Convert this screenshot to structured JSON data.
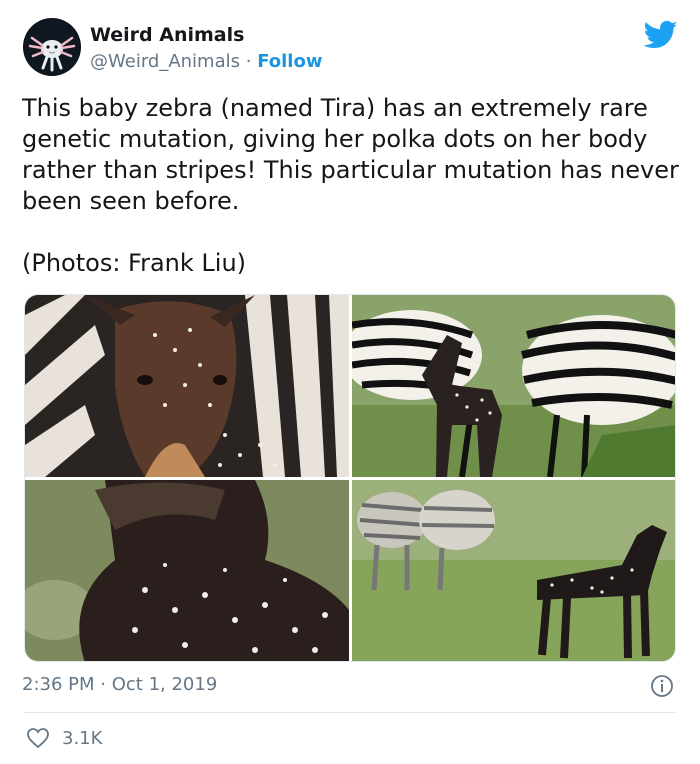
{
  "account": {
    "name": "Weird Animals",
    "handle": "@Weird_Animals",
    "separator": "·",
    "follow_label": "Follow"
  },
  "tweet": {
    "text": "This baby zebra (named Tira) has an extremely rare genetic mutation, giving her polka dots on her body rather than stripes! This particular mutation has never been seen before.",
    "credit": "(Photos: Frank Liu)"
  },
  "meta": {
    "time": "2:36 PM",
    "separator": "·",
    "date": "Oct 1, 2019"
  },
  "engagement": {
    "likes": "3.1K"
  },
  "colors": {
    "link": "#1b95e0",
    "text": "#14171a",
    "muted": "#657786",
    "border": "#e1e8ed"
  },
  "icons": {
    "brand": "twitter-bird-icon",
    "info": "info-icon",
    "like": "heart-icon"
  }
}
